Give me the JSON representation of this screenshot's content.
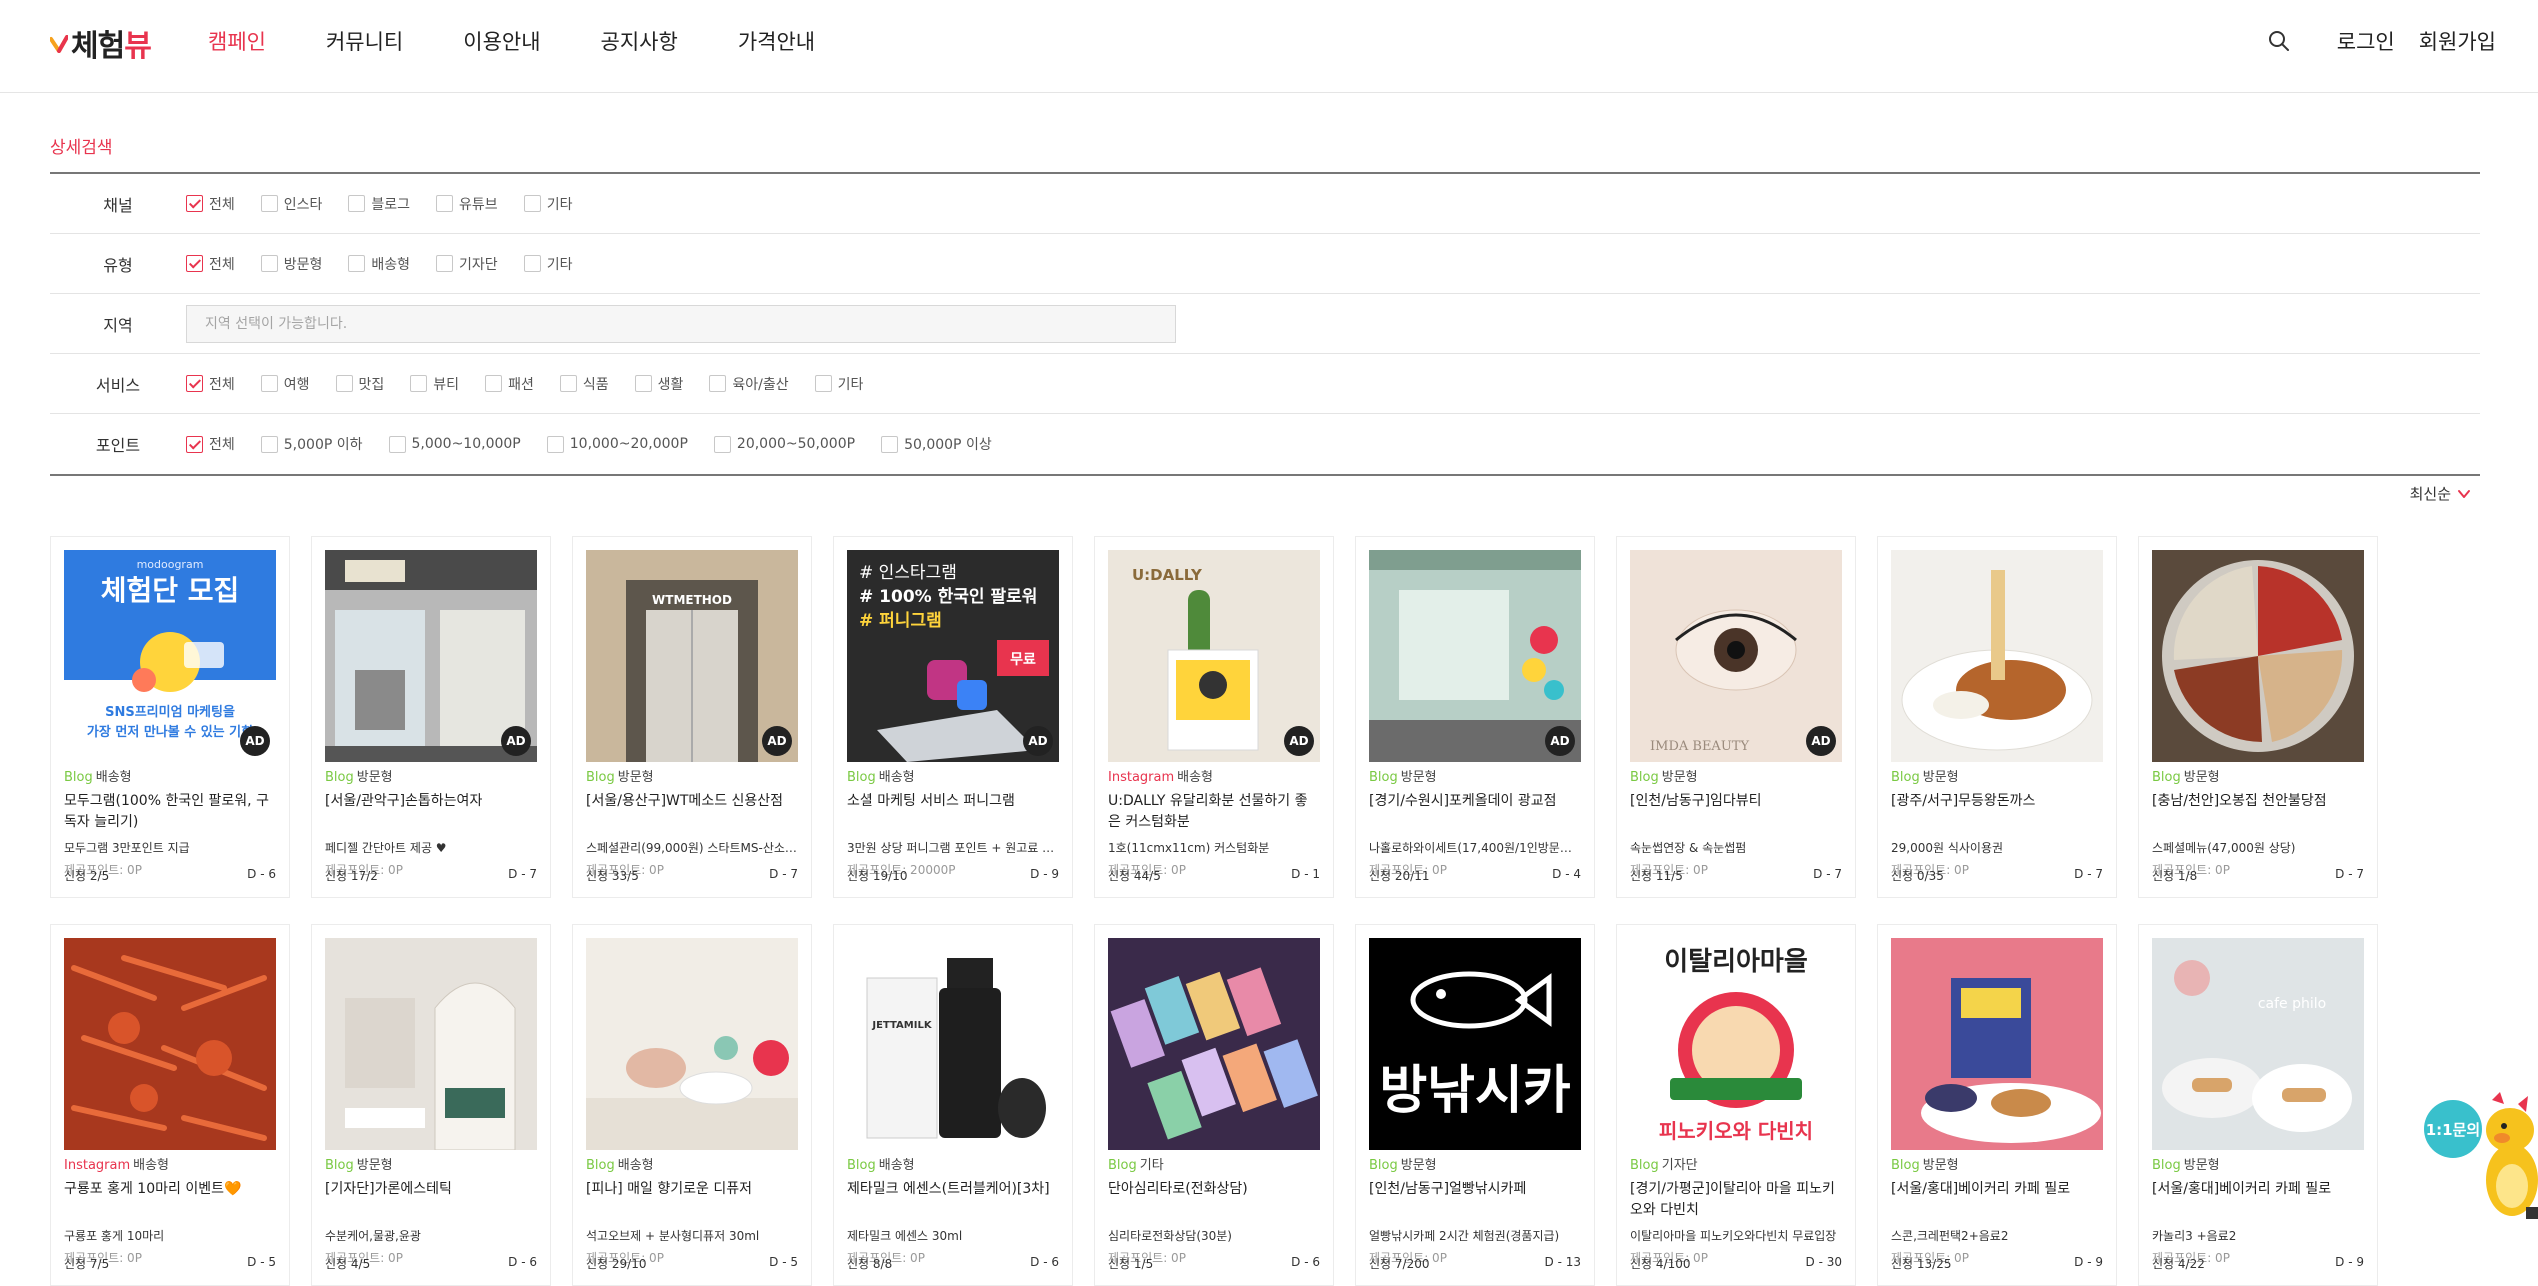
{
  "header": {
    "logo_a": "체험",
    "logo_b": "뷰",
    "nav": [
      "캠페인",
      "커뮤니티",
      "이용안내",
      "공지사항",
      "가격안내"
    ],
    "login": "로그인",
    "signup": "회원가입"
  },
  "filters": {
    "title": "상세검색",
    "channel": {
      "label": "채널",
      "options": [
        "전체",
        "인스타",
        "블로그",
        "유튜브",
        "기타"
      ]
    },
    "type": {
      "label": "유형",
      "options": [
        "전체",
        "방문형",
        "배송형",
        "기자단",
        "기타"
      ]
    },
    "region": {
      "label": "지역",
      "placeholder": "지역 선택이 가능합니다."
    },
    "service": {
      "label": "서비스",
      "options": [
        "전체",
        "여행",
        "맛집",
        "뷰티",
        "패션",
        "식품",
        "생활",
        "육아/출산",
        "기타"
      ]
    },
    "point": {
      "label": "포인트",
      "options": [
        "전체",
        "5,000P 이하",
        "5,000~10,000P",
        "10,000~20,000P",
        "20,000~50,000P",
        "50,000P 이상"
      ]
    }
  },
  "sort_label": "최신순",
  "ad_label": "AD",
  "campaigns": [
    {
      "channel": "Blog",
      "type": "배송형",
      "title": "모두그램(100% 한국인 팔로워, 구독자 늘리기)",
      "desc": "모두그램 3만포인트 지급",
      "points": "제공포인트: 0P",
      "apply": "신청 2/5",
      "dday": "D - 6",
      "ad": true
    },
    {
      "channel": "Blog",
      "type": "방문형",
      "title": "[서울/관악구]손톱하는여자",
      "desc": "페디젤 간단아트 제공 ♥",
      "points": "제공포인트: 0P",
      "apply": "신청 17/2",
      "dday": "D - 7",
      "ad": true
    },
    {
      "channel": "Blog",
      "type": "방문형",
      "title": "[서울/용산구]WT메소드 신용산점",
      "desc": "스페셜관리(99,000원) 스타트MS-산소 ...",
      "points": "제공포인트: 0P",
      "apply": "신청 33/5",
      "dday": "D - 7",
      "ad": true
    },
    {
      "channel": "Blog",
      "type": "배송형",
      "title": "소셜 마케팅 서비스 퍼니그램",
      "desc": "3만원 상당 퍼니그램 포인트 + 원고료 2...",
      "points": "제공포인트: 20000P",
      "apply": "신청 19/10",
      "dday": "D - 9",
      "ad": true
    },
    {
      "channel": "Instagram",
      "type": "배송형",
      "title": "U:DALLY 유달리화분 선물하기 좋은 커스텀화분",
      "desc": "1호(11cmx11cm) 커스텀화분",
      "points": "제공포인트: 0P",
      "apply": "신청 44/5",
      "dday": "D - 1",
      "ad": true
    },
    {
      "channel": "Blog",
      "type": "방문형",
      "title": "[경기/수원시]포케올데이 광교점",
      "desc": "나홀로하와이세트(17,400원/1인방문시)...",
      "points": "제공포인트: 0P",
      "apply": "신청 20/11",
      "dday": "D - 4",
      "ad": true
    },
    {
      "channel": "Blog",
      "type": "방문형",
      "title": "[인천/남동구]임다뷰티",
      "desc": "속눈썹연장 & 속눈썹펌",
      "points": "제공포인트: 0P",
      "apply": "신청 11/5",
      "dday": "D - 7",
      "ad": true
    },
    {
      "channel": "Blog",
      "type": "방문형",
      "title": "[광주/서구]무등왕돈까스",
      "desc": "29,000원 식사이용권",
      "points": "제공포인트: 0P",
      "apply": "신청 0/35",
      "dday": "D - 7",
      "ad": false
    },
    {
      "channel": "Blog",
      "type": "방문형",
      "title": "[충남/천안]오봉집 천안불당점",
      "desc": "스페셜메뉴(47,000원 상당)",
      "points": "제공포인트: 0P",
      "apply": "신청 1/8",
      "dday": "D - 7",
      "ad": false
    },
    {
      "channel": "Instagram",
      "type": "배송형",
      "title": "구룡포 홍게 10마리 이벤트🧡",
      "desc": "구룡포 홍게 10마리",
      "points": "제공포인트: 0P",
      "apply": "신청 7/5",
      "dday": "D - 5",
      "ad": false
    },
    {
      "channel": "Blog",
      "type": "방문형",
      "title": "[기자단]가론에스테틱",
      "desc": "수분케어,물광,윤광",
      "points": "제공포인트: 0P",
      "apply": "신청 4/5",
      "dday": "D - 6",
      "ad": false
    },
    {
      "channel": "Blog",
      "type": "배송형",
      "title": "[피나] 매일 향기로운 디퓨저",
      "desc": "석고오브제 + 분사형디퓨저 30ml",
      "points": "제공포인트: 0P",
      "apply": "신청 29/10",
      "dday": "D - 5",
      "ad": false
    },
    {
      "channel": "Blog",
      "type": "배송형",
      "title": "제타밀크 에센스(트러블케어)[3차]",
      "desc": "제타밀크 에센스 30ml",
      "points": "제공포인트: 0P",
      "apply": "신청 8/8",
      "dday": "D - 6",
      "ad": false
    },
    {
      "channel": "Blog",
      "type": "기타",
      "title": "단아심리타로(전화상담)",
      "desc": "심리타로전화상담(30분)",
      "points": "제공포인트: 0P",
      "apply": "신청 1/5",
      "dday": "D - 6",
      "ad": false
    },
    {
      "channel": "Blog",
      "type": "방문형",
      "title": "[인천/남동구]얼빵낚시카페",
      "desc": "얼빵낚시카페 2시간 체험권(경품지급)",
      "points": "제공포인트: 0P",
      "apply": "신청 7/200",
      "dday": "D - 13",
      "ad": false
    },
    {
      "channel": "Blog",
      "type": "기자단",
      "title": "[경기/가평군]이탈리아 마을 피노키오와 다빈치",
      "desc": "이탈리아마을 피노키오와다빈치 무료입장",
      "points": "제공포인트: 0P",
      "apply": "신청 4/100",
      "dday": "D - 30",
      "ad": false
    },
    {
      "channel": "Blog",
      "type": "방문형",
      "title": "[서울/홍대]베이커리 카페 필로",
      "desc": "스콘,크레펀택2+음료2",
      "points": "제공포인트: 0P",
      "apply": "신청 13/25",
      "dday": "D - 9",
      "ad": false
    },
    {
      "channel": "Blog",
      "type": "방문형",
      "title": "[서울/홍대]베이커리 카페 필로",
      "desc": "카놀리3 +음료2",
      "points": "제공포인트: 0P",
      "apply": "신청 4/22",
      "dday": "D - 9",
      "ad": false
    }
  ],
  "thumb_text": {
    "t0_brand": "modoogram",
    "t0_headline": "체험단 모집",
    "t0_line1": "SNS프리미엄 마케팅을",
    "t0_line2": "가장 먼저 만나볼 수 있는 기회",
    "t2_sign": "WTMETHOD",
    "t3_line1": "# 인스타그램",
    "t3_line2": "# 100% 한국인 팔로워",
    "t3_line3": "# 퍼니그램",
    "t3_badge": "무료",
    "t4_brand": "U:DALLY",
    "t6_brand": "IMDA BEAUTY",
    "t12_brand": "JETTAMILK",
    "t14_text": "방낚시카",
    "t15_top": "이탈리아마을",
    "t15_bottom": "피노키오와 다빈치",
    "t17_text": "cafe philo"
  },
  "chat_label": "1:1문의",
  "colors": {
    "accent": "#e8344e",
    "blog": "#7ac943",
    "instagram": "#e8344e",
    "chat": "#39c0cc"
  }
}
